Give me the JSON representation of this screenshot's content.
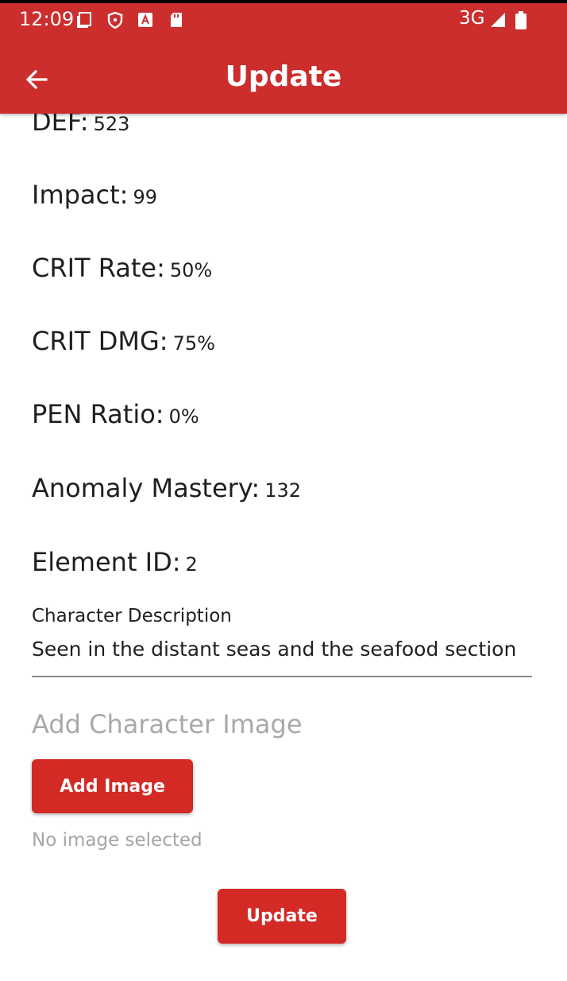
{
  "status_bar": {
    "time": "12:09",
    "network": "3G",
    "icons": [
      "screen-icon",
      "shield-icon",
      "a-icon",
      "sd-card-icon",
      "signal-icon",
      "battery-icon"
    ]
  },
  "app_bar": {
    "title": "Update",
    "back_icon": "arrow-left-icon",
    "color": "#cb2e2d"
  },
  "fields": [
    {
      "label": "DEF:",
      "value": "523"
    },
    {
      "label": "Impact:",
      "value": "99"
    },
    {
      "label": "CRIT Rate:",
      "value": "50%"
    },
    {
      "label": "CRIT DMG:",
      "value": "75%"
    },
    {
      "label": "PEN Ratio:",
      "value": "0%"
    },
    {
      "label": "Anomaly Mastery:",
      "value": "132"
    },
    {
      "label": "Element ID:",
      "value": "2"
    }
  ],
  "description": {
    "label": "Character Description",
    "value": "Seen in the distant seas and the seafood section"
  },
  "image_section": {
    "heading": "Add Character Image",
    "button_label": "Add Image",
    "status": "No image selected"
  },
  "submit": {
    "label": "Update",
    "color": "#d32a26"
  }
}
